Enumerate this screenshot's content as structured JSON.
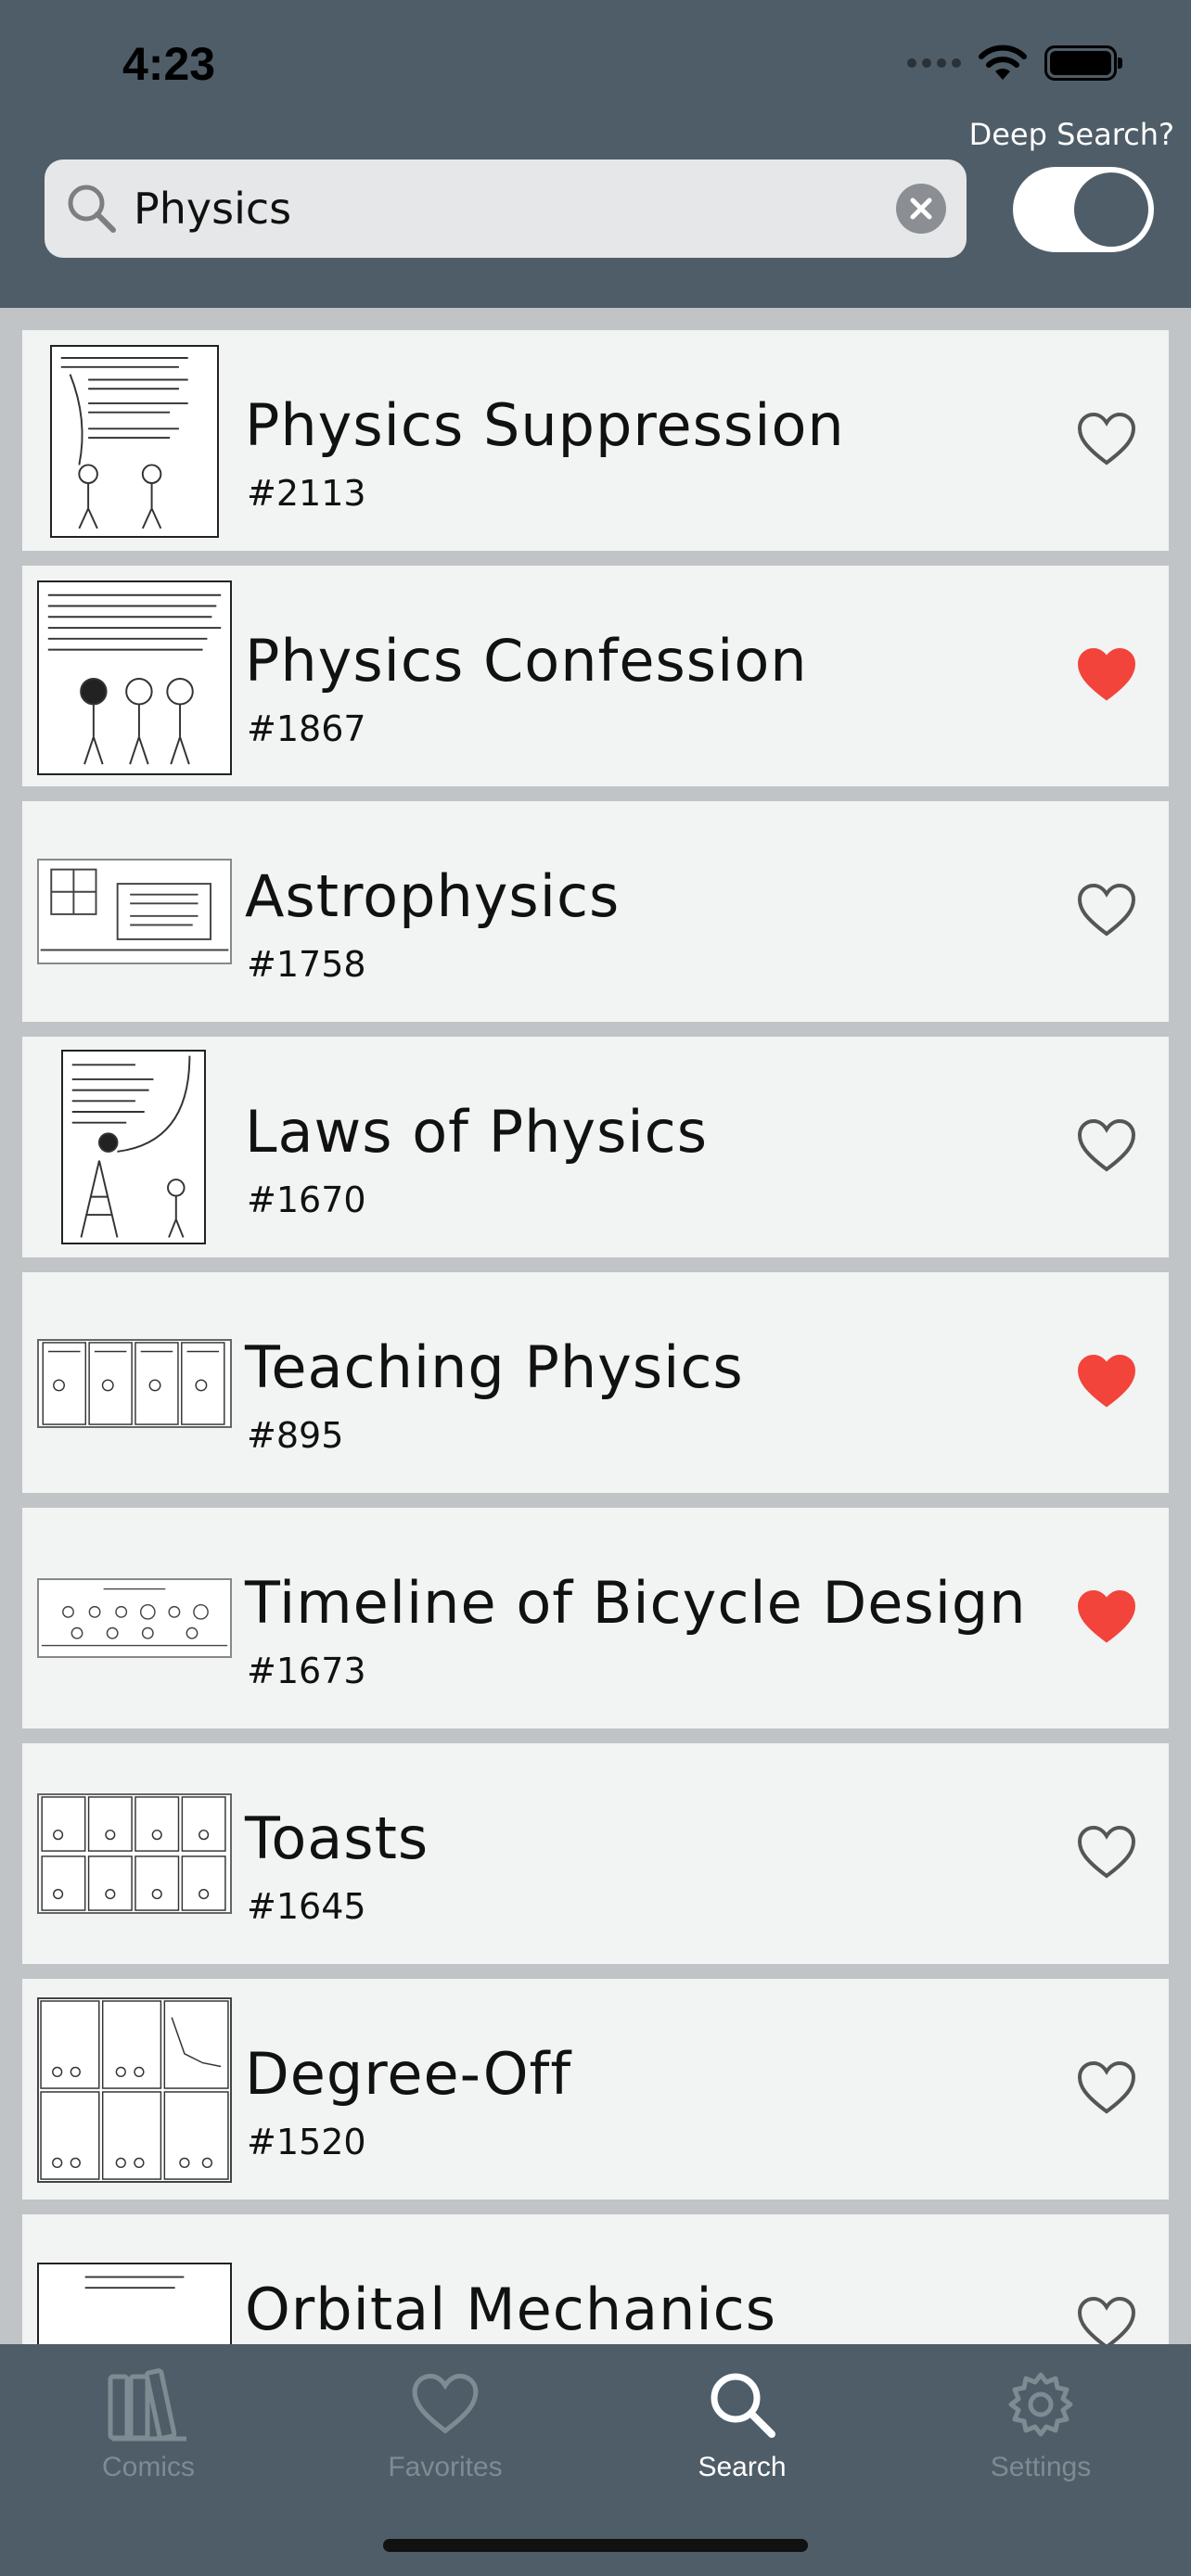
{
  "status_bar": {
    "time": "4:23"
  },
  "search": {
    "value": "Physics",
    "placeholder": "",
    "deep_search_label": "Deep Search?",
    "deep_search_on": true
  },
  "comics": [
    {
      "title": "Physics Suppression",
      "number": "#2113",
      "favorite": false
    },
    {
      "title": "Physics Confession",
      "number": "#1867",
      "favorite": true
    },
    {
      "title": "Astrophysics",
      "number": "#1758",
      "favorite": false
    },
    {
      "title": "Laws of Physics",
      "number": "#1670",
      "favorite": false
    },
    {
      "title": "Teaching Physics",
      "number": "#895",
      "favorite": true
    },
    {
      "title": "Timeline of Bicycle Design",
      "number": "#1673",
      "favorite": true
    },
    {
      "title": "Toasts",
      "number": "#1645",
      "favorite": false
    },
    {
      "title": "Degree-Off",
      "number": "#1520",
      "favorite": false
    },
    {
      "title": "Orbital Mechanics",
      "number": "",
      "favorite": false
    }
  ],
  "tabs": [
    {
      "label": "Comics",
      "icon": "books-icon",
      "active": false
    },
    {
      "label": "Favorites",
      "icon": "heart-icon",
      "active": false
    },
    {
      "label": "Search",
      "icon": "search-icon",
      "active": true
    },
    {
      "label": "Settings",
      "icon": "gear-icon",
      "active": false
    }
  ],
  "colors": {
    "header": "#4e5d68",
    "favorite": "#f2443a",
    "heart_outline": "#555555",
    "tab_inactive": "#7f8b93",
    "tab_active": "#ffffff"
  }
}
